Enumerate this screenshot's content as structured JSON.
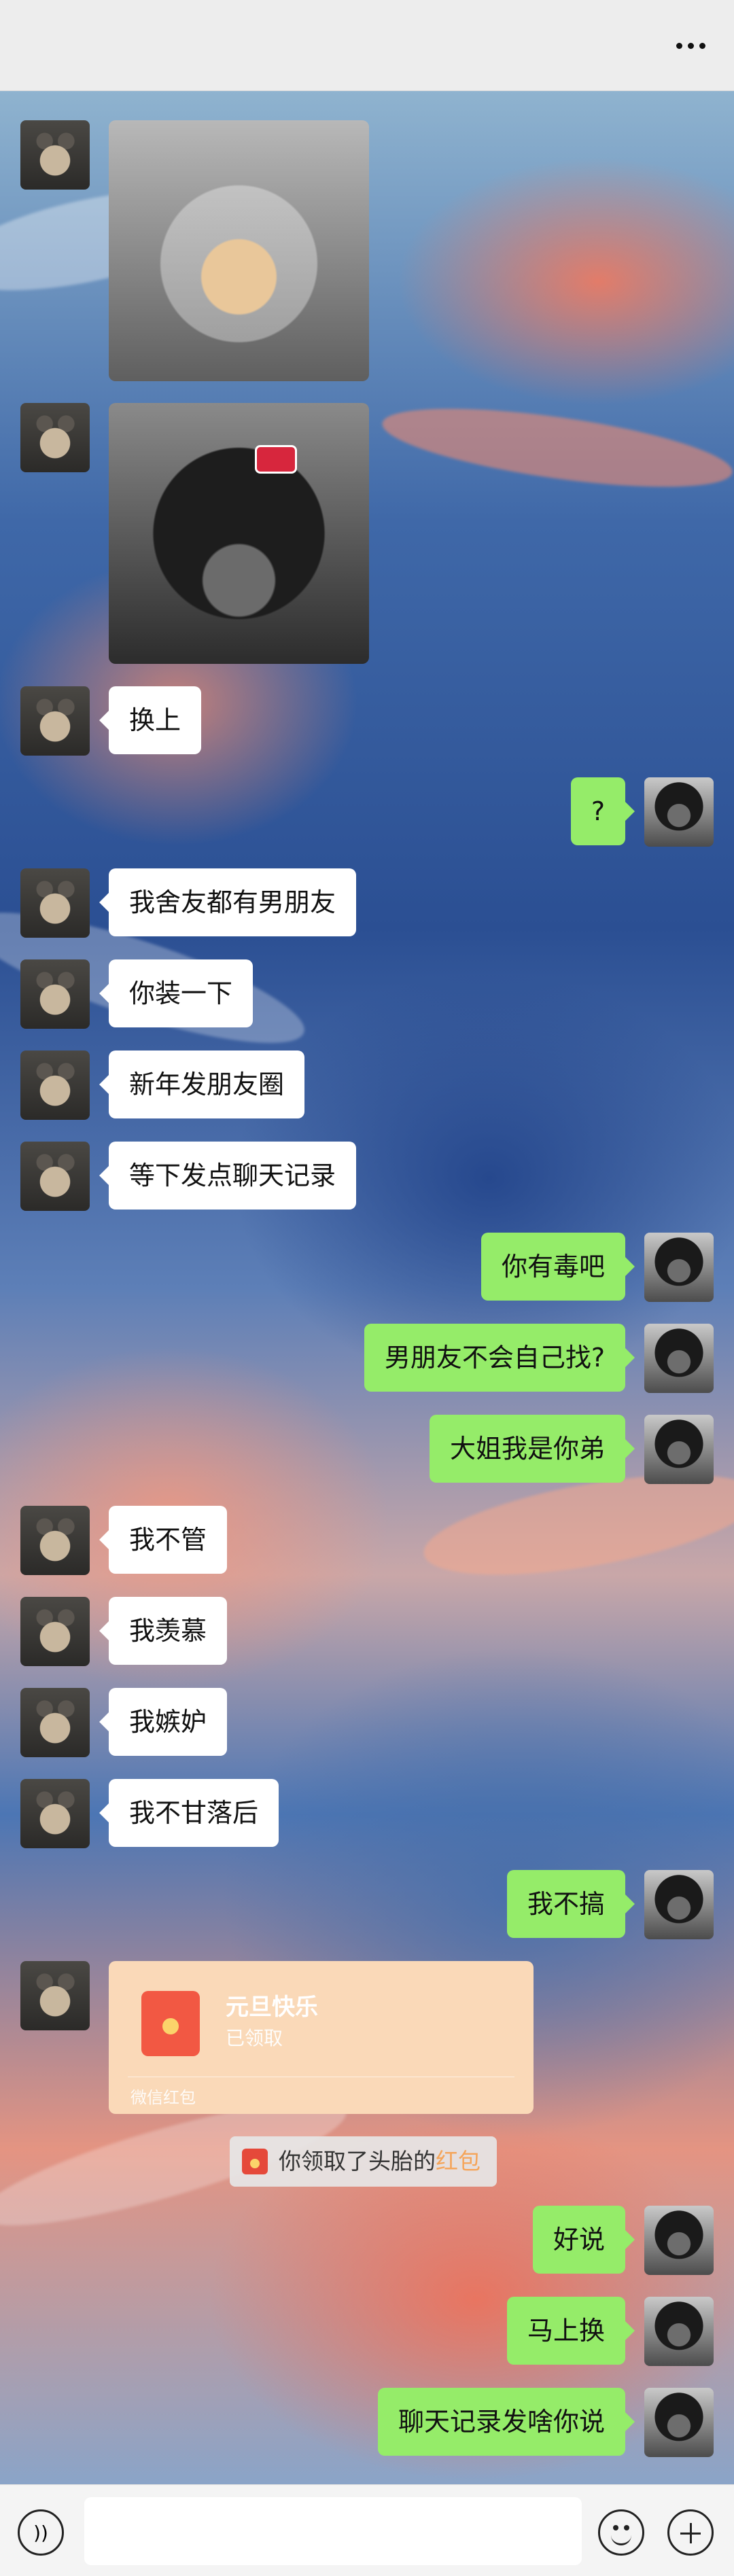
{
  "topbar": {
    "more_icon": "ellipsis-icon"
  },
  "messages": [
    {
      "side": "left",
      "type": "image",
      "image": "astronaut-cat"
    },
    {
      "side": "left",
      "type": "image",
      "image": "helmet-cat"
    },
    {
      "side": "left",
      "type": "text",
      "text": "换上"
    },
    {
      "side": "right",
      "type": "text",
      "text": "?"
    },
    {
      "side": "left",
      "type": "text",
      "text": "我舍友都有男朋友"
    },
    {
      "side": "left",
      "type": "text",
      "text": "你装一下"
    },
    {
      "side": "left",
      "type": "text",
      "text": "新年发朋友圈"
    },
    {
      "side": "left",
      "type": "text",
      "text": "等下发点聊天记录"
    },
    {
      "side": "right",
      "type": "text",
      "text": "你有毒吧"
    },
    {
      "side": "right",
      "type": "text",
      "text": "男朋友不会自己找?"
    },
    {
      "side": "right",
      "type": "text",
      "text": "大姐我是你弟"
    },
    {
      "side": "left",
      "type": "text",
      "text": "我不管"
    },
    {
      "side": "left",
      "type": "text",
      "text": "我羡慕"
    },
    {
      "side": "left",
      "type": "text",
      "text": "我嫉妒"
    },
    {
      "side": "left",
      "type": "text",
      "text": "我不甘落后"
    },
    {
      "side": "right",
      "type": "text",
      "text": "我不搞"
    },
    {
      "side": "left",
      "type": "red_packet",
      "title": "元旦快乐",
      "status": "已领取",
      "footer": "微信红包"
    },
    {
      "side": "right",
      "type": "text",
      "text": "好说"
    },
    {
      "side": "right",
      "type": "text",
      "text": "马上换"
    },
    {
      "side": "right",
      "type": "text",
      "text": "聊天记录发啥你说"
    }
  ],
  "system_notice": {
    "prefix": "你领取了头胎的",
    "highlight": "红包"
  },
  "input_bar": {
    "voice_icon": "voice-icon",
    "emoji_icon": "emoji-icon",
    "plus_icon": "plus-icon"
  },
  "colors": {
    "right_bubble": "#95ec69",
    "left_bubble": "#ffffff",
    "red_packet": "#fad9b8",
    "highlight": "#f5a55a"
  }
}
